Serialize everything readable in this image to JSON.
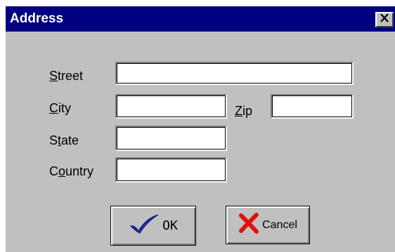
{
  "window": {
    "title": "Address",
    "close_glyph": "✕"
  },
  "form": {
    "street": {
      "label_mnemonic": "S",
      "label_rest": "treet",
      "value": ""
    },
    "city": {
      "label_mnemonic": "C",
      "label_rest": "ity",
      "value": ""
    },
    "zip": {
      "label_mnemonic": "Z",
      "label_rest": "ip",
      "value": ""
    },
    "state": {
      "label_pre": "S",
      "label_mnemonic": "t",
      "label_rest": "ate",
      "value": ""
    },
    "country": {
      "label_pre": "C",
      "label_mnemonic": "o",
      "label_rest": "untry",
      "value": ""
    }
  },
  "buttons": {
    "ok": {
      "label": "OK",
      "icon": "checkmark-icon",
      "icon_color": "#1a2db8"
    },
    "cancel": {
      "label": "Cancel",
      "icon": "x-icon",
      "icon_color": "#e01010"
    }
  }
}
